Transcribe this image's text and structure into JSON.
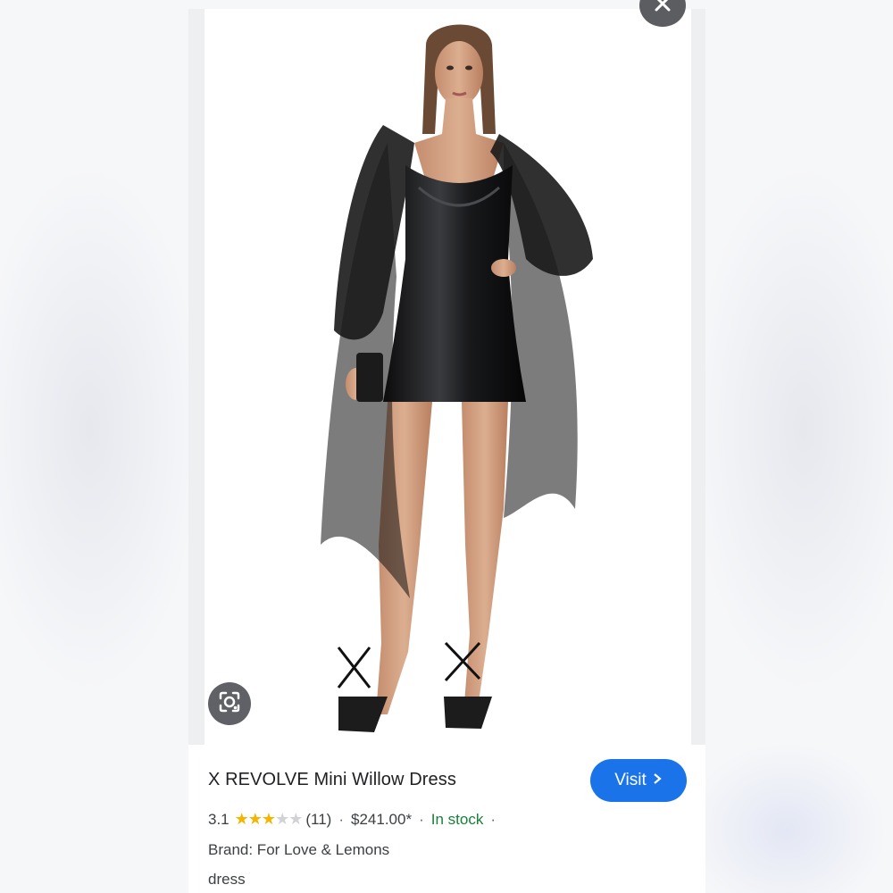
{
  "product": {
    "title": "X REVOLVE Mini Willow Dress",
    "rating": "3.1",
    "stars_filled": 3,
    "stars_total": 5,
    "review_count": "(11)",
    "price": "$241.00*",
    "availability": "In stock",
    "brand": "Brand: For Love & Lemons",
    "category": "dress"
  },
  "buttons": {
    "visit_label": "Visit",
    "close_icon": "close-icon",
    "lens_icon": "lens-search-icon"
  },
  "colors": {
    "visit_button": "#1a73e8",
    "in_stock": "#188038",
    "star_filled": "#f4b400",
    "star_empty": "#d0d2d5"
  },
  "image": {
    "subject": "model in black mini dress with sheer draped sleeves"
  }
}
